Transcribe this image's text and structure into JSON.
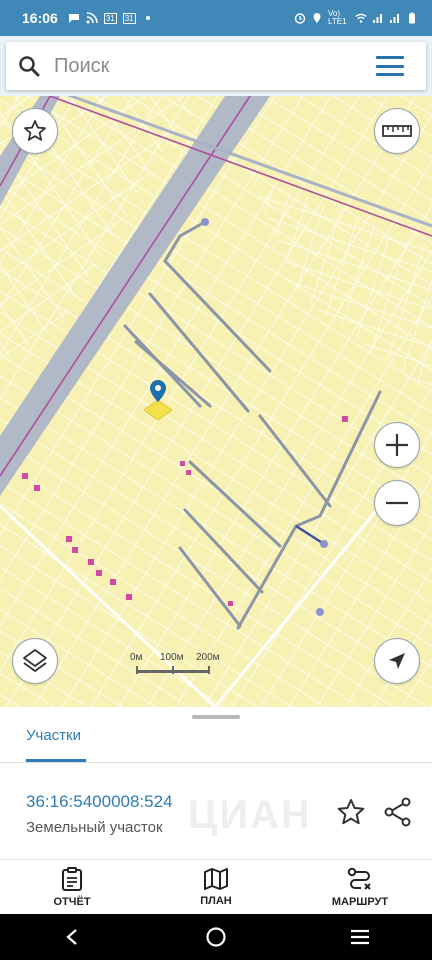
{
  "status_bar": {
    "time": "16:06",
    "calendar_day": "31",
    "network": "Vo) LTE1"
  },
  "search": {
    "placeholder": "Поиск"
  },
  "map": {
    "scale_labels": [
      "0м",
      "100м",
      "200м"
    ],
    "colors": {
      "background": "#f7f1b3",
      "parcel_lines": "#ffffff",
      "road_band": "#a9b3c8",
      "boundary_line": "#b04e9d",
      "paths": "#8b95a8",
      "marker": "#1e6fae"
    }
  },
  "sheet": {
    "tab_label": "Участки",
    "parcel_id": "36:16:5400008:524",
    "parcel_type": "Земельный участок"
  },
  "bottom_nav": {
    "items": [
      {
        "label": "ОТЧЁТ",
        "icon": "report-icon"
      },
      {
        "label": "ПЛАН",
        "icon": "map-plan-icon"
      },
      {
        "label": "МАРШРУТ",
        "icon": "route-icon"
      }
    ]
  },
  "colors": {
    "accent": "#2f7cb4",
    "status_bar": "#3f88b8"
  }
}
